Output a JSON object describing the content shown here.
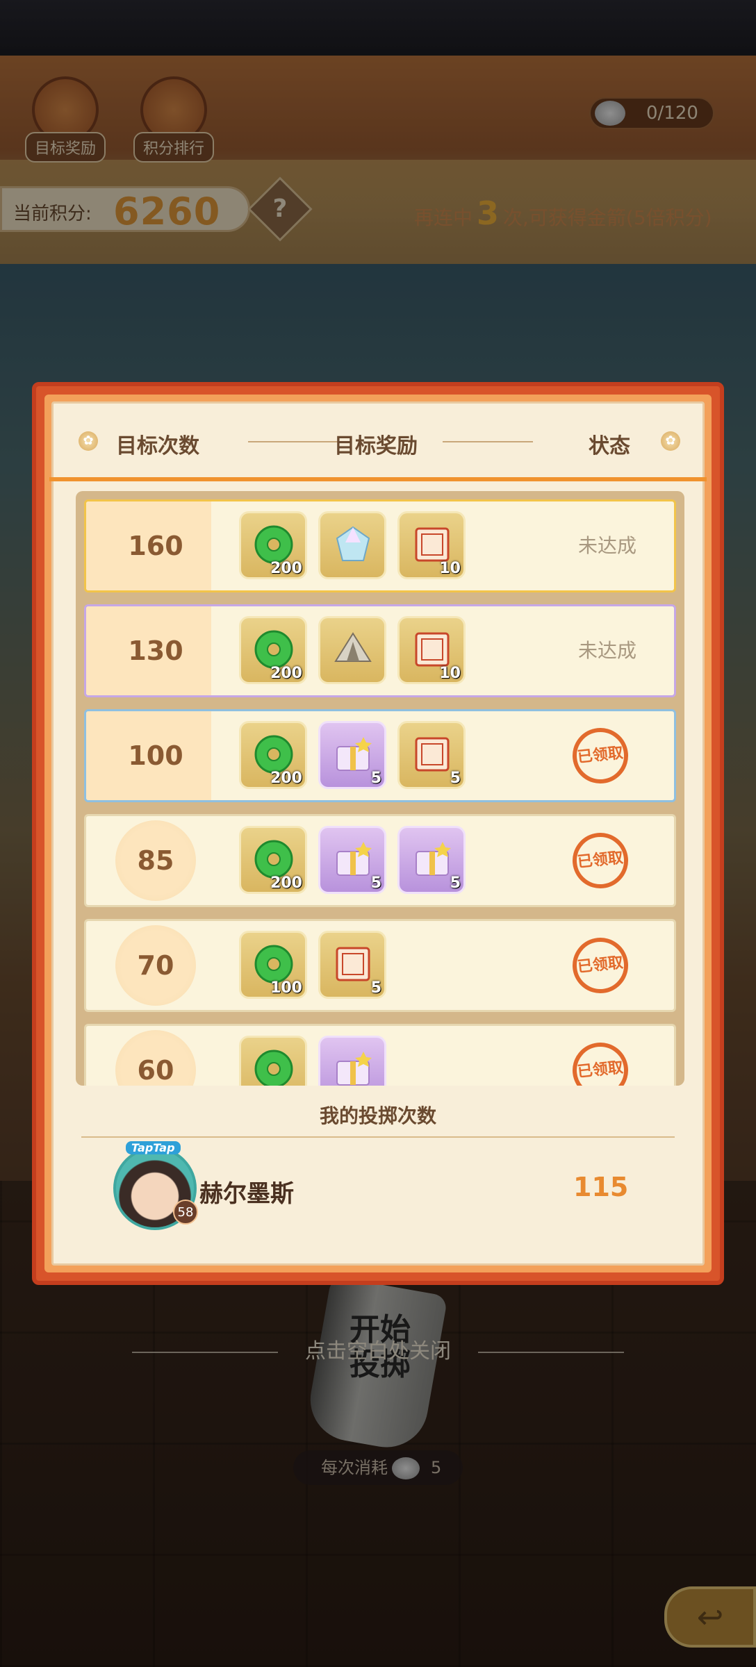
{
  "hud": {
    "target_reward_label": "目标奖励",
    "score_rank_label": "积分排行",
    "coin_counter": "0/120",
    "score_label": "当前积分:",
    "score_value": "6260",
    "help_icon": "question-icon",
    "streak": {
      "prefix": "再连中",
      "count": "3",
      "suffix": "次,可获得金箭(5倍积分)"
    }
  },
  "modal": {
    "headers": {
      "target_count": "目标次数",
      "target_reward": "目标奖励",
      "status": "状态"
    },
    "rows": [
      {
        "count": "160",
        "tier": "gold",
        "rewards": [
          {
            "icon": "jade-coin-icon",
            "qty": "200"
          },
          {
            "icon": "crystal-gem-icon",
            "qty": ""
          },
          {
            "icon": "lucky-ticket-icon",
            "qty": "10"
          }
        ],
        "status": "未达成"
      },
      {
        "count": "130",
        "tier": "purple",
        "rewards": [
          {
            "icon": "jade-coin-icon",
            "qty": "200"
          },
          {
            "icon": "tent-icon",
            "qty": ""
          },
          {
            "icon": "lucky-ticket-icon",
            "qty": "10"
          }
        ],
        "status": "未达成"
      },
      {
        "count": "100",
        "tier": "blue",
        "rewards": [
          {
            "icon": "jade-coin-icon",
            "qty": "200"
          },
          {
            "icon": "purple-gift-box-icon",
            "qty": "5"
          },
          {
            "icon": "lucky-ticket-icon",
            "qty": "5"
          }
        ],
        "status": "已领取"
      },
      {
        "count": "85",
        "tier": "plain",
        "rewards": [
          {
            "icon": "jade-coin-icon",
            "qty": "200"
          },
          {
            "icon": "purple-gift-box-icon",
            "qty": "5"
          },
          {
            "icon": "purple-gift-box-icon",
            "qty": "5"
          }
        ],
        "status": "已领取"
      },
      {
        "count": "70",
        "tier": "plain",
        "rewards": [
          {
            "icon": "jade-coin-icon",
            "qty": "100"
          },
          {
            "icon": "lucky-ticket-icon",
            "qty": "5"
          }
        ],
        "status": "已领取"
      },
      {
        "count": "60",
        "tier": "plain",
        "rewards": [
          {
            "icon": "jade-coin-icon",
            "qty": ""
          },
          {
            "icon": "purple-gift-box-icon",
            "qty": ""
          }
        ],
        "status": "已领取"
      }
    ],
    "my_throws_title": "我的投掷次数",
    "player": {
      "avatar_badge": "TapTap",
      "level": "58",
      "name": "赫尔墨斯",
      "throws": "115"
    }
  },
  "footer": {
    "cup_text": "开始\n投掷",
    "close_hint": "点击空白处关闭",
    "cost_label": "每次消耗",
    "cost_value": "5"
  },
  "colors": {
    "accent_orange": "#f0922e",
    "modal_border": "#d8542a",
    "claimed_stamp": "#e26a2c"
  }
}
